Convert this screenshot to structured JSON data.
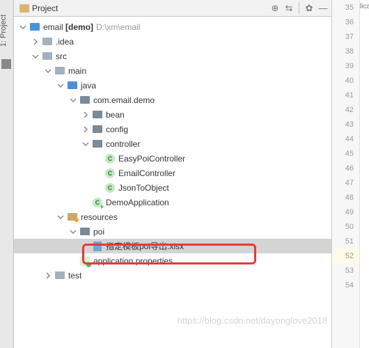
{
  "header": {
    "project_label": "Project",
    "sidebar_tab": "1: Project",
    "right_cut": "lication"
  },
  "tree": {
    "root": {
      "name": "email",
      "tag": "[demo]",
      "path": "D:\\xm\\email"
    },
    "idea": ".idea",
    "src": "src",
    "main": "main",
    "java": "java",
    "pkg": "com.email.demo",
    "bean": "bean",
    "config": "config",
    "controller": "controller",
    "easypoi": "EasyPoiController",
    "emailctrl": "EmailController",
    "jsonobj": "JsonToObject",
    "demoapp": "DemoApplication",
    "resources": "resources",
    "poi": "poi",
    "xlsx": "指定模板poi导出.xlsx",
    "appprops": "application.properties",
    "test": "test"
  },
  "gutter": {
    "start": 35,
    "end": 54,
    "highlight": 52
  },
  "watermark": "https://blog.csdn.net/dayonglove2018"
}
